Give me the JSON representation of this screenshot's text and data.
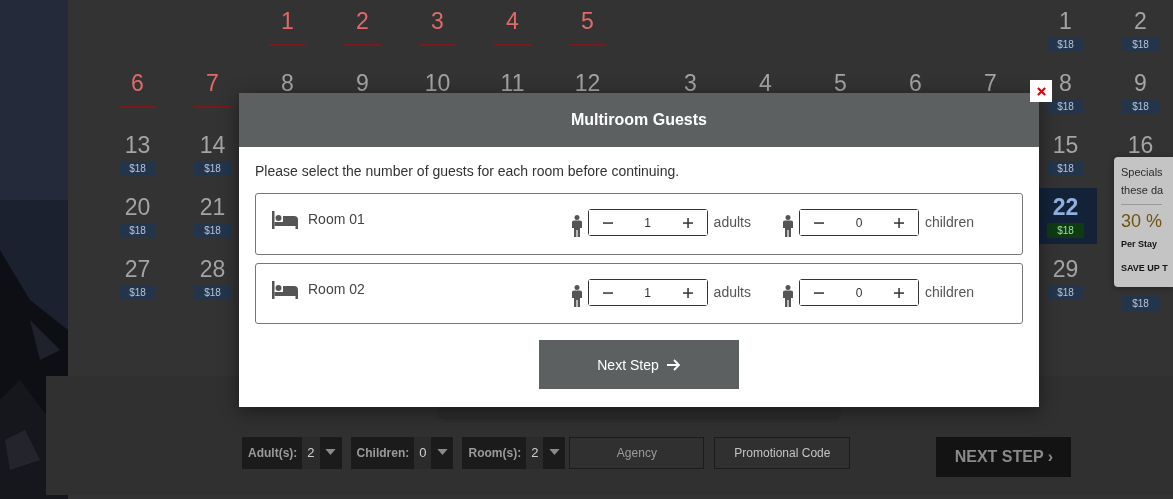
{
  "calendars": [
    {
      "days": [
        {
          "kind": "blank"
        },
        {
          "kind": "blank"
        },
        {
          "kind": "unavailable",
          "day": "1",
          "selected": false
        },
        {
          "kind": "unavailable",
          "day": "2",
          "selected": false
        },
        {
          "kind": "unavailable",
          "day": "3",
          "selected": false
        },
        {
          "kind": "unavailable",
          "day": "4",
          "selected": false
        },
        {
          "kind": "unavailable",
          "day": "5",
          "selected": false
        },
        {
          "kind": "unavailable",
          "day": "6",
          "selected": false
        },
        {
          "kind": "unavailable",
          "day": "7",
          "selected": false
        },
        {
          "kind": "plain",
          "day": "8",
          "selected": false
        },
        {
          "kind": "plain",
          "day": "9",
          "selected": false
        },
        {
          "kind": "plain",
          "day": "10",
          "selected": false
        },
        {
          "kind": "plain",
          "day": "11",
          "selected": false
        },
        {
          "kind": "plain",
          "day": "12",
          "selected": false
        },
        {
          "kind": "price",
          "day": "13",
          "price": "$18",
          "selected": false
        },
        {
          "kind": "price",
          "day": "14",
          "price": "$18",
          "selected": false
        },
        {
          "kind": "blank"
        },
        {
          "kind": "blank"
        },
        {
          "kind": "blank"
        },
        {
          "kind": "blank"
        },
        {
          "kind": "blank"
        },
        {
          "kind": "price",
          "day": "20",
          "price": "$18",
          "selected": false
        },
        {
          "kind": "price",
          "day": "21",
          "price": "$18",
          "selected": false
        },
        {
          "kind": "blank"
        },
        {
          "kind": "blank"
        },
        {
          "kind": "blank"
        },
        {
          "kind": "blank"
        },
        {
          "kind": "blank"
        },
        {
          "kind": "price",
          "day": "27",
          "price": "$18",
          "selected": false
        },
        {
          "kind": "price",
          "day": "28",
          "price": "$18",
          "selected": false
        }
      ]
    },
    {
      "days": [
        {
          "kind": "blank"
        },
        {
          "kind": "blank"
        },
        {
          "kind": "blank"
        },
        {
          "kind": "blank"
        },
        {
          "kind": "blank"
        },
        {
          "kind": "price",
          "day": "1",
          "price": "$18",
          "selected": false
        },
        {
          "kind": "price",
          "day": "2",
          "price": "$18",
          "selected": false
        },
        {
          "kind": "plain",
          "day": "3",
          "selected": false
        },
        {
          "kind": "plain",
          "day": "4",
          "selected": false
        },
        {
          "kind": "plain",
          "day": "5",
          "selected": false
        },
        {
          "kind": "plain",
          "day": "6",
          "selected": false
        },
        {
          "kind": "plain",
          "day": "7",
          "selected": false
        },
        {
          "kind": "price",
          "day": "8",
          "price": "$18",
          "selected": false
        },
        {
          "kind": "price",
          "day": "9",
          "price": "$18",
          "selected": false
        },
        {
          "kind": "blank"
        },
        {
          "kind": "blank"
        },
        {
          "kind": "blank"
        },
        {
          "kind": "blank"
        },
        {
          "kind": "blank"
        },
        {
          "kind": "price",
          "day": "15",
          "price": "$18",
          "selected": false
        },
        {
          "kind": "plain",
          "day": "16",
          "selected": false
        },
        {
          "kind": "blank"
        },
        {
          "kind": "blank"
        },
        {
          "kind": "blank"
        },
        {
          "kind": "blank"
        },
        {
          "kind": "blank"
        },
        {
          "kind": "price",
          "day": "22",
          "price": "$18",
          "selected": true
        },
        {
          "kind": "blank"
        },
        {
          "kind": "blank"
        },
        {
          "kind": "blank"
        },
        {
          "kind": "blank"
        },
        {
          "kind": "blank"
        },
        {
          "kind": "blank"
        },
        {
          "kind": "price",
          "day": "29",
          "price": "$18",
          "selected": false
        },
        {
          "kind": "tag-only",
          "price": "$18"
        }
      ]
    }
  ],
  "tooltip": {
    "lines": [
      {
        "kind": "note",
        "text": "Specials"
      },
      {
        "kind": "note",
        "text": "these da"
      },
      {
        "kind": "discount",
        "text": "30 %"
      },
      {
        "kind": "label",
        "text": "Per Stay"
      },
      {
        "kind": "label",
        "text": "SAVE UP T"
      }
    ]
  },
  "booking_bar": {
    "selects": [
      {
        "label": "Adult(s):",
        "value": "2"
      },
      {
        "label": "Children:",
        "value": "0"
      },
      {
        "label": "Room(s):",
        "value": "2"
      }
    ],
    "agency": {
      "placeholder": "Agency"
    },
    "promo_button": "Promotional Code",
    "next_button": "NEXT STEP ›"
  },
  "modal": {
    "title": "Multiroom Guests",
    "instruction": "Please select the number of guests for each room before continuing.",
    "rooms": [
      {
        "name": "Room 01",
        "adults": "1",
        "adults_label": "adults",
        "children": "0",
        "children_label": "children"
      },
      {
        "name": "Room 02",
        "adults": "1",
        "adults_label": "adults",
        "children": "0",
        "children_label": "children"
      }
    ],
    "button": "Next Step"
  }
}
